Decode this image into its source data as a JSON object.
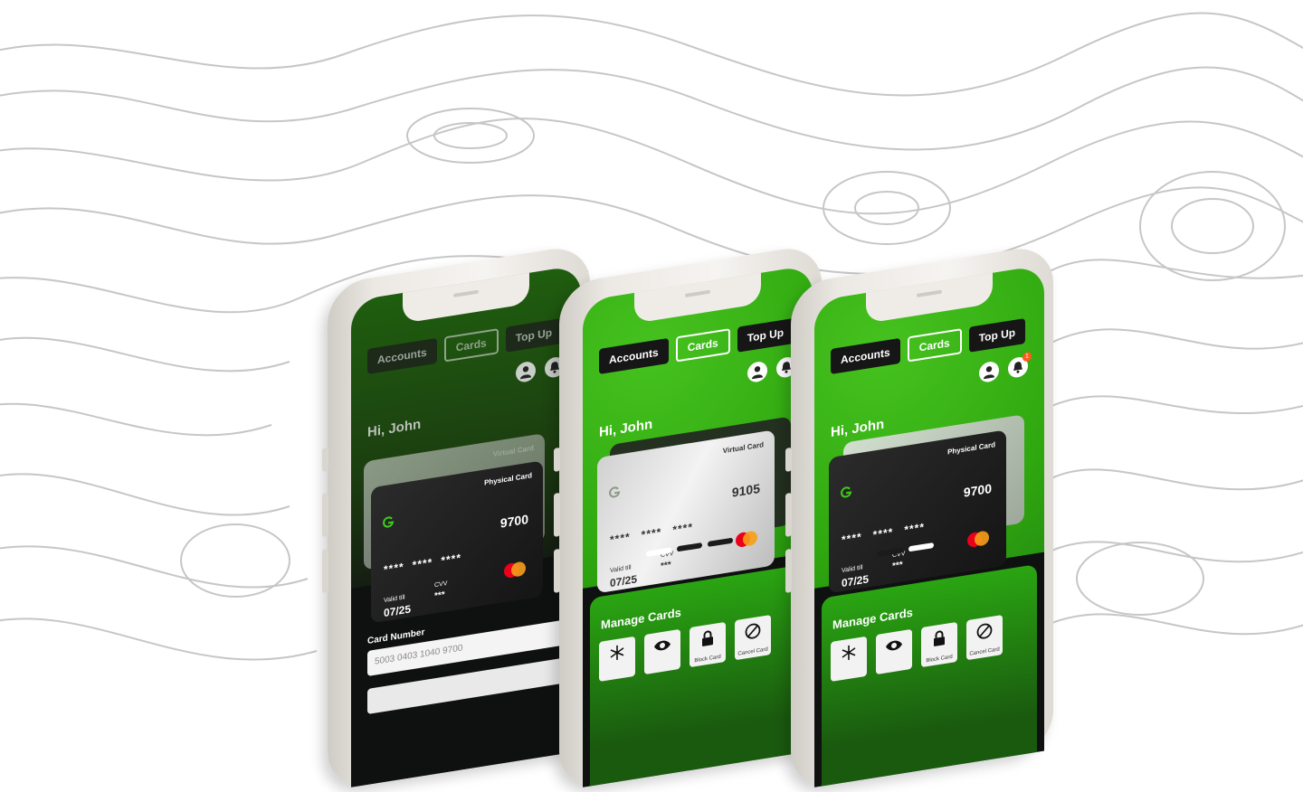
{
  "phones": [
    {
      "tabs": {
        "accounts": "Accounts",
        "cards": "Cards",
        "topup": "Top Up"
      },
      "notification_count": "1",
      "greeting": "Hi, John",
      "back_card": {
        "type": "Virtual Card"
      },
      "front_card": {
        "type": "Physical Card",
        "stars": [
          "****",
          "****",
          "****"
        ],
        "last4": "9700",
        "valid_label": "Valid till",
        "valid_value": "07/25",
        "cvv_label": "CVV",
        "cvv_value": "***"
      },
      "form": {
        "card_number_label": "Card Number",
        "card_number_value": "5003 0403 1040 9700"
      }
    },
    {
      "tabs": {
        "accounts": "Accounts",
        "cards": "Cards",
        "topup": "Top Up"
      },
      "notification_count": "1",
      "greeting": "Hi, John",
      "front_card": {
        "type": "Virtual Card",
        "stars": [
          "****",
          "****",
          "****"
        ],
        "last4": "9105",
        "valid_label": "Valid till",
        "valid_value": "07/25",
        "cvv_label": "CVV",
        "cvv_value": "***"
      },
      "active_dot": 0,
      "manage": {
        "title": "Manage Cards",
        "block": "Block Card",
        "cancel": "Cancel Card"
      }
    },
    {
      "tabs": {
        "accounts": "Accounts",
        "cards": "Cards",
        "topup": "Top Up"
      },
      "notification_count": "1",
      "greeting": "Hi, John",
      "front_card": {
        "type": "Physical Card",
        "stars": [
          "****",
          "****",
          "****"
        ],
        "last4": "9700",
        "valid_label": "Valid till",
        "valid_value": "07/25",
        "cvv_label": "CVV",
        "cvv_value": "***"
      },
      "active_dot": 1,
      "manage": {
        "title": "Manage Cards",
        "block": "Block Card",
        "cancel": "Cancel Card"
      }
    }
  ],
  "colors": {
    "brand_green": "#2fa70f",
    "dark": "#151515",
    "mastercard_red": "#eb001b",
    "mastercard_orange": "#f79e1b"
  }
}
